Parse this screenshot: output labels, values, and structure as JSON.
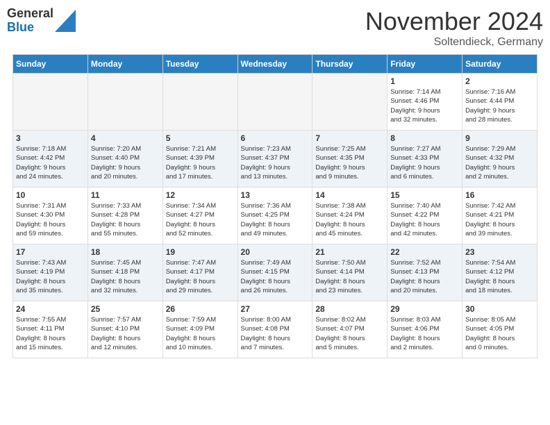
{
  "header": {
    "logo_general": "General",
    "logo_blue": "Blue",
    "month_title": "November 2024",
    "location": "Soltendieck, Germany"
  },
  "calendar": {
    "days_of_week": [
      "Sunday",
      "Monday",
      "Tuesday",
      "Wednesday",
      "Thursday",
      "Friday",
      "Saturday"
    ],
    "weeks": [
      [
        {
          "day": "",
          "info": ""
        },
        {
          "day": "",
          "info": ""
        },
        {
          "day": "",
          "info": ""
        },
        {
          "day": "",
          "info": ""
        },
        {
          "day": "",
          "info": ""
        },
        {
          "day": "1",
          "info": "Sunrise: 7:14 AM\nSunset: 4:46 PM\nDaylight: 9 hours\nand 32 minutes."
        },
        {
          "day": "2",
          "info": "Sunrise: 7:16 AM\nSunset: 4:44 PM\nDaylight: 9 hours\nand 28 minutes."
        }
      ],
      [
        {
          "day": "3",
          "info": "Sunrise: 7:18 AM\nSunset: 4:42 PM\nDaylight: 9 hours\nand 24 minutes."
        },
        {
          "day": "4",
          "info": "Sunrise: 7:20 AM\nSunset: 4:40 PM\nDaylight: 9 hours\nand 20 minutes."
        },
        {
          "day": "5",
          "info": "Sunrise: 7:21 AM\nSunset: 4:39 PM\nDaylight: 9 hours\nand 17 minutes."
        },
        {
          "day": "6",
          "info": "Sunrise: 7:23 AM\nSunset: 4:37 PM\nDaylight: 9 hours\nand 13 minutes."
        },
        {
          "day": "7",
          "info": "Sunrise: 7:25 AM\nSunset: 4:35 PM\nDaylight: 9 hours\nand 9 minutes."
        },
        {
          "day": "8",
          "info": "Sunrise: 7:27 AM\nSunset: 4:33 PM\nDaylight: 9 hours\nand 6 minutes."
        },
        {
          "day": "9",
          "info": "Sunrise: 7:29 AM\nSunset: 4:32 PM\nDaylight: 9 hours\nand 2 minutes."
        }
      ],
      [
        {
          "day": "10",
          "info": "Sunrise: 7:31 AM\nSunset: 4:30 PM\nDaylight: 8 hours\nand 59 minutes."
        },
        {
          "day": "11",
          "info": "Sunrise: 7:33 AM\nSunset: 4:28 PM\nDaylight: 8 hours\nand 55 minutes."
        },
        {
          "day": "12",
          "info": "Sunrise: 7:34 AM\nSunset: 4:27 PM\nDaylight: 8 hours\nand 52 minutes."
        },
        {
          "day": "13",
          "info": "Sunrise: 7:36 AM\nSunset: 4:25 PM\nDaylight: 8 hours\nand 49 minutes."
        },
        {
          "day": "14",
          "info": "Sunrise: 7:38 AM\nSunset: 4:24 PM\nDaylight: 8 hours\nand 45 minutes."
        },
        {
          "day": "15",
          "info": "Sunrise: 7:40 AM\nSunset: 4:22 PM\nDaylight: 8 hours\nand 42 minutes."
        },
        {
          "day": "16",
          "info": "Sunrise: 7:42 AM\nSunset: 4:21 PM\nDaylight: 8 hours\nand 39 minutes."
        }
      ],
      [
        {
          "day": "17",
          "info": "Sunrise: 7:43 AM\nSunset: 4:19 PM\nDaylight: 8 hours\nand 35 minutes."
        },
        {
          "day": "18",
          "info": "Sunrise: 7:45 AM\nSunset: 4:18 PM\nDaylight: 8 hours\nand 32 minutes."
        },
        {
          "day": "19",
          "info": "Sunrise: 7:47 AM\nSunset: 4:17 PM\nDaylight: 8 hours\nand 29 minutes."
        },
        {
          "day": "20",
          "info": "Sunrise: 7:49 AM\nSunset: 4:15 PM\nDaylight: 8 hours\nand 26 minutes."
        },
        {
          "day": "21",
          "info": "Sunrise: 7:50 AM\nSunset: 4:14 PM\nDaylight: 8 hours\nand 23 minutes."
        },
        {
          "day": "22",
          "info": "Sunrise: 7:52 AM\nSunset: 4:13 PM\nDaylight: 8 hours\nand 20 minutes."
        },
        {
          "day": "23",
          "info": "Sunrise: 7:54 AM\nSunset: 4:12 PM\nDaylight: 8 hours\nand 18 minutes."
        }
      ],
      [
        {
          "day": "24",
          "info": "Sunrise: 7:55 AM\nSunset: 4:11 PM\nDaylight: 8 hours\nand 15 minutes."
        },
        {
          "day": "25",
          "info": "Sunrise: 7:57 AM\nSunset: 4:10 PM\nDaylight: 8 hours\nand 12 minutes."
        },
        {
          "day": "26",
          "info": "Sunrise: 7:59 AM\nSunset: 4:09 PM\nDaylight: 8 hours\nand 10 minutes."
        },
        {
          "day": "27",
          "info": "Sunrise: 8:00 AM\nSunset: 4:08 PM\nDaylight: 8 hours\nand 7 minutes."
        },
        {
          "day": "28",
          "info": "Sunrise: 8:02 AM\nSunset: 4:07 PM\nDaylight: 8 hours\nand 5 minutes."
        },
        {
          "day": "29",
          "info": "Sunrise: 8:03 AM\nSunset: 4:06 PM\nDaylight: 8 hours\nand 2 minutes."
        },
        {
          "day": "30",
          "info": "Sunrise: 8:05 AM\nSunset: 4:05 PM\nDaylight: 8 hours\nand 0 minutes."
        }
      ]
    ]
  }
}
